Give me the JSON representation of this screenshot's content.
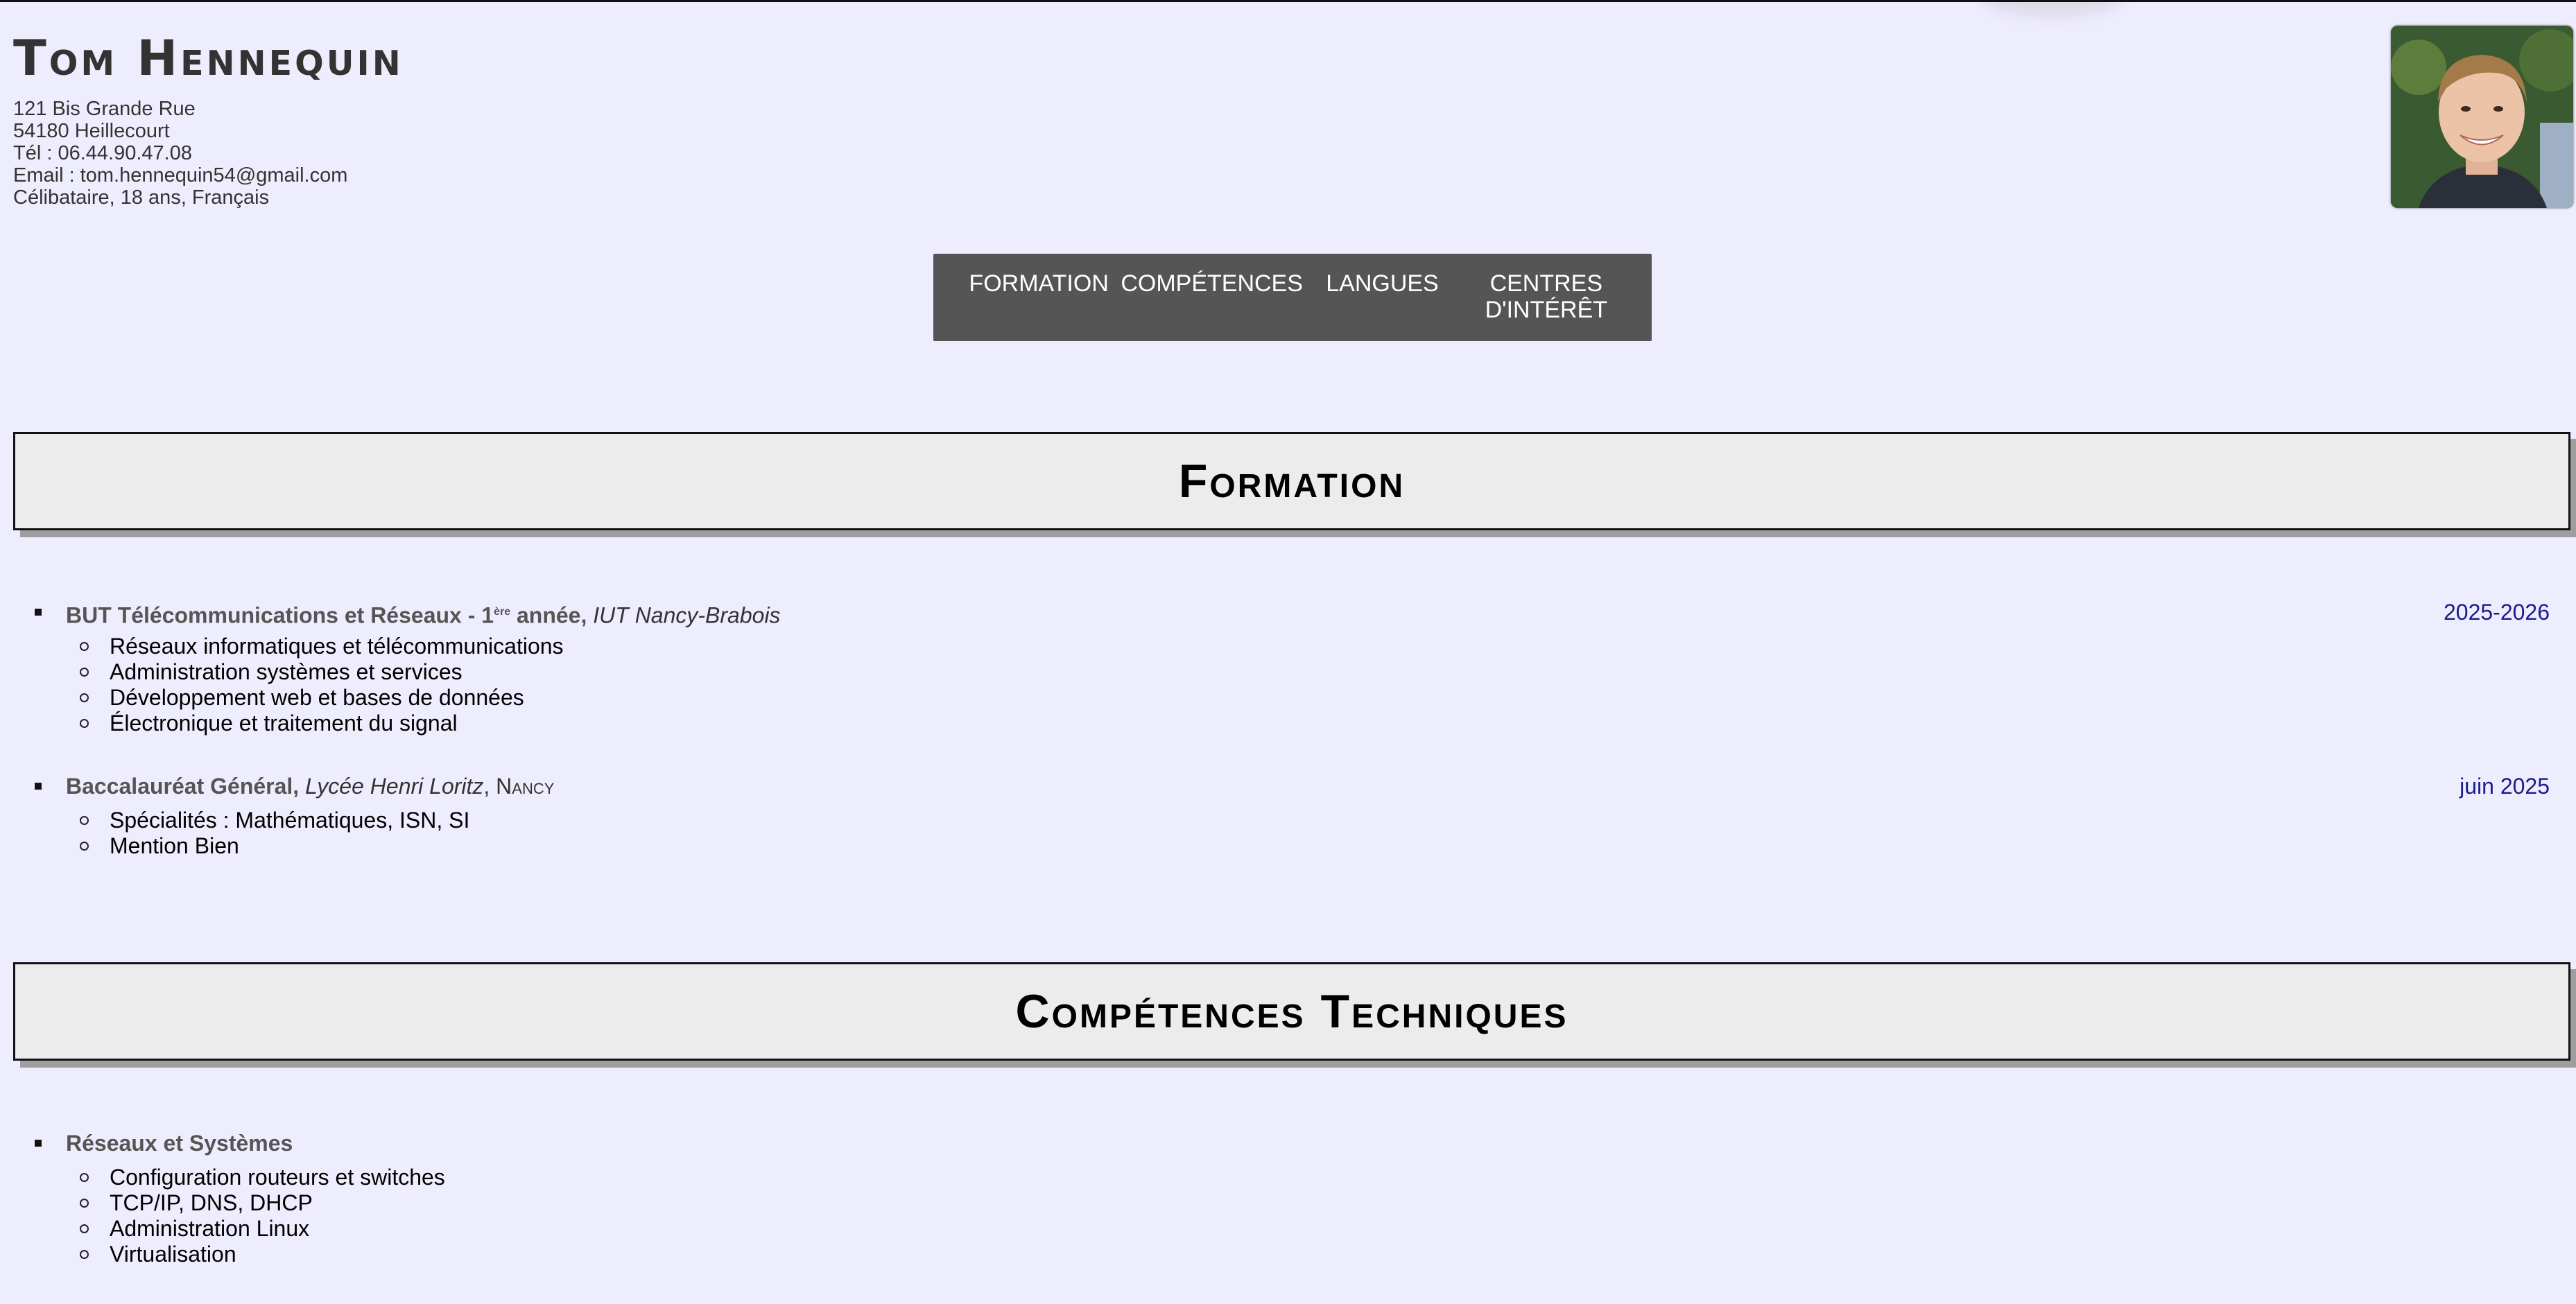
{
  "header": {
    "name": "Tom Hennequin",
    "address_line1": "121 Bis Grande Rue",
    "address_line2": "54180 Heillecourt",
    "phone": "Tél : 06.44.90.47.08",
    "email": "Email : tom.hennequin54@gmail.com",
    "status": "Célibataire, 18 ans, Français"
  },
  "nav": {
    "items": [
      "FORMATION",
      "COMPÉTENCES",
      "LANGUES",
      "CENTRES D'INTÉRÊT"
    ]
  },
  "formation": {
    "title": "Formation",
    "entries": [
      {
        "degree": "BUT Télécommunications et Réseaux - 1",
        "sup": "ère",
        "degree_suffix": " année, ",
        "institution": "IUT Nancy-Brabois",
        "date": "2025-2026",
        "items": [
          "Réseaux informatiques et télécommunications",
          "Administration systèmes et services",
          "Développement web et bases de données",
          "Électronique et traitement du signal"
        ]
      },
      {
        "degree": "Baccalauréat Général, ",
        "institution": "Lycée Henri Loritz",
        "city": "Nancy",
        "date": "juin 2025",
        "items": [
          "Spécialités : Mathématiques, ISN, SI",
          "Mention Bien"
        ]
      }
    ]
  },
  "competences": {
    "title": "Compétences Techniques",
    "entries": [
      {
        "category": "Réseaux et Systèmes",
        "items": [
          "Configuration routeurs et switches",
          "TCP/IP, DNS, DHCP",
          "Administration Linux",
          "Virtualisation"
        ]
      }
    ]
  }
}
